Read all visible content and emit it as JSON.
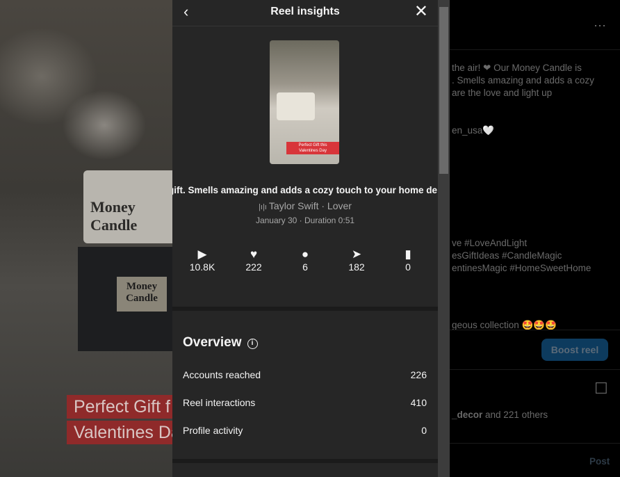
{
  "background": {
    "jar_text": "Money Candle",
    "box_text": "Money Candle",
    "label_line1": "Perfect Gift f",
    "label_line2": "Valentines Da"
  },
  "modal": {
    "title": "Reel insights",
    "thumbnail_label": "Perfect Gift this Valentines Day",
    "caption": "gift. Smells amazing and adds a cozy touch to your home de",
    "music": "Taylor Swift · Lover",
    "date_line": "January 30 · Duration 0:51",
    "stats": [
      {
        "icon": "play-icon",
        "glyph": "▶",
        "value": "10.8K"
      },
      {
        "icon": "heart-icon",
        "glyph": "♥",
        "value": "222"
      },
      {
        "icon": "comment-icon",
        "glyph": "●",
        "value": "6"
      },
      {
        "icon": "share-icon",
        "glyph": "➤",
        "value": "182"
      },
      {
        "icon": "bookmark-icon",
        "glyph": "🔖",
        "value": "0"
      }
    ],
    "overview": {
      "title": "Overview",
      "rows": [
        {
          "label": "Accounts reached",
          "value": "226"
        },
        {
          "label": "Reel interactions",
          "value": "410"
        },
        {
          "label": "Profile activity",
          "value": "0"
        }
      ]
    }
  },
  "post": {
    "caption_lines": [
      "the air! ❤ Our Money Candle is",
      ". Smells amazing and adds a cozy",
      "are the love and light up",
      "en_usa🤍",
      "ve #LoveAndLight",
      "esGiftIdeas #CandleMagic",
      "entinesMagic #HomeSweetHome"
    ],
    "comment": "geous collection 🤩🤩🤩",
    "boost_label": "Boost reel",
    "likes_user": "_decor",
    "likes_text": " and 221 others",
    "post_label": "Post",
    "more": "···"
  }
}
